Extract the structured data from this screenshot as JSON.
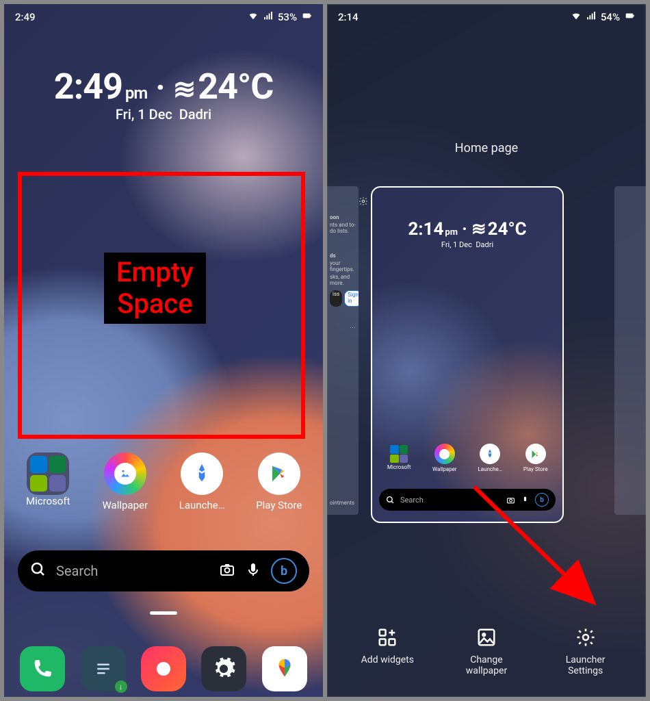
{
  "left": {
    "status": {
      "time": "2:49",
      "battery": "53%"
    },
    "clock": {
      "time": "2:49",
      "ampm": "pm",
      "temp": "24°C",
      "date": "Fri, 1 Dec",
      "location": "Dadri"
    },
    "annotation": {
      "line1": "Empty",
      "line2": "Space"
    },
    "apps": [
      {
        "label": "Microsoft"
      },
      {
        "label": "Wallpaper"
      },
      {
        "label": "Launche…"
      },
      {
        "label": "Play Store"
      }
    ],
    "search": {
      "placeholder": "Search"
    }
  },
  "right": {
    "status": {
      "time": "2:14",
      "battery": "54%"
    },
    "title": "Home page",
    "side_left": {
      "snip1_title": "oon",
      "snip1_sub": "nts and to-do lists.",
      "snip2_title": "ds",
      "snip2_sub": "your fingertips.",
      "snip2_sub2": "sks, and more.",
      "btn_dismiss": "iss",
      "btn_signin": "Sign in",
      "snip3": "ointments"
    },
    "preview": {
      "clock": {
        "time": "2:14",
        "ampm": "pm",
        "temp": "24°C",
        "date": "Fri, 1 Dec",
        "location": "Dadri"
      },
      "apps": [
        {
          "label": "Microsoft"
        },
        {
          "label": "Wallpaper"
        },
        {
          "label": "Launche…"
        },
        {
          "label": "Play Store"
        }
      ],
      "search": {
        "placeholder": "Search"
      }
    },
    "options": [
      {
        "label": "Add widgets"
      },
      {
        "label": "Change\nwallpaper"
      },
      {
        "label": "Launcher\nSettings"
      }
    ]
  }
}
